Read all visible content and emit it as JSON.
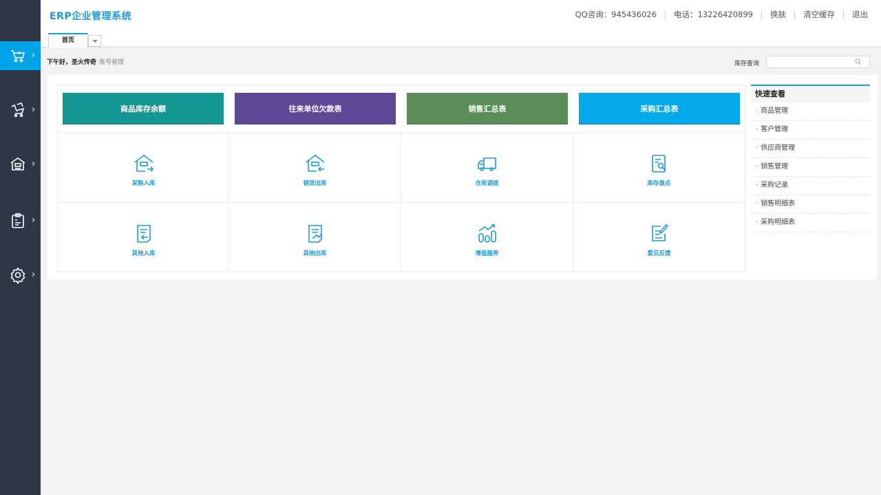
{
  "app": {
    "title": "ERP企业管理系统"
  },
  "header": {
    "links": [
      {
        "label": "QQ咨询：945436026"
      },
      {
        "label": "电话：13226420899"
      },
      {
        "label": "换肤"
      },
      {
        "label": "清空缓存"
      },
      {
        "label": "退出"
      }
    ]
  },
  "sidebar": {
    "items": [
      {
        "icon": "cart-icon",
        "active": true
      },
      {
        "icon": "shopping-list-icon",
        "active": false
      },
      {
        "icon": "warehouse-icon",
        "active": false
      },
      {
        "icon": "clipboard-icon",
        "active": false
      },
      {
        "icon": "gear-icon",
        "active": false
      }
    ]
  },
  "tabs": {
    "home": "首页"
  },
  "greeting": {
    "text": "下午好，圣火传奇",
    "account_link": "账号管理"
  },
  "stock_search": {
    "label": "库存查询",
    "value": ""
  },
  "report_buttons": [
    {
      "label": "商品库存余额",
      "color": "#149693"
    },
    {
      "label": "往来单位欠款表",
      "color": "#5e4797"
    },
    {
      "label": "销售汇总表",
      "color": "#5a8d57"
    },
    {
      "label": "采购汇总表",
      "color": "#03a9e8"
    }
  ],
  "shortcuts": [
    {
      "label": "采购入库",
      "icon": "purchase-in-icon"
    },
    {
      "label": "销货出库",
      "icon": "sales-out-icon"
    },
    {
      "label": "仓库调拨",
      "icon": "truck-icon"
    },
    {
      "label": "库存盘点",
      "icon": "inventory-check-icon"
    },
    {
      "label": "其他入库",
      "icon": "other-in-icon"
    },
    {
      "label": "其他出库",
      "icon": "other-out-icon"
    },
    {
      "label": "增值服务",
      "icon": "growth-chart-icon"
    },
    {
      "label": "意见反馈",
      "icon": "feedback-icon"
    }
  ],
  "quick_view": {
    "title": "快速查看",
    "items": [
      "商品管理",
      "客户管理",
      "供应商管理",
      "销售管理",
      "采购记录",
      "销售明细表",
      "采购明细表"
    ]
  },
  "colors": {
    "accent": "#1b9ad6",
    "sidebar": "#2f3646",
    "sidebar_active": "#00a2e8"
  }
}
